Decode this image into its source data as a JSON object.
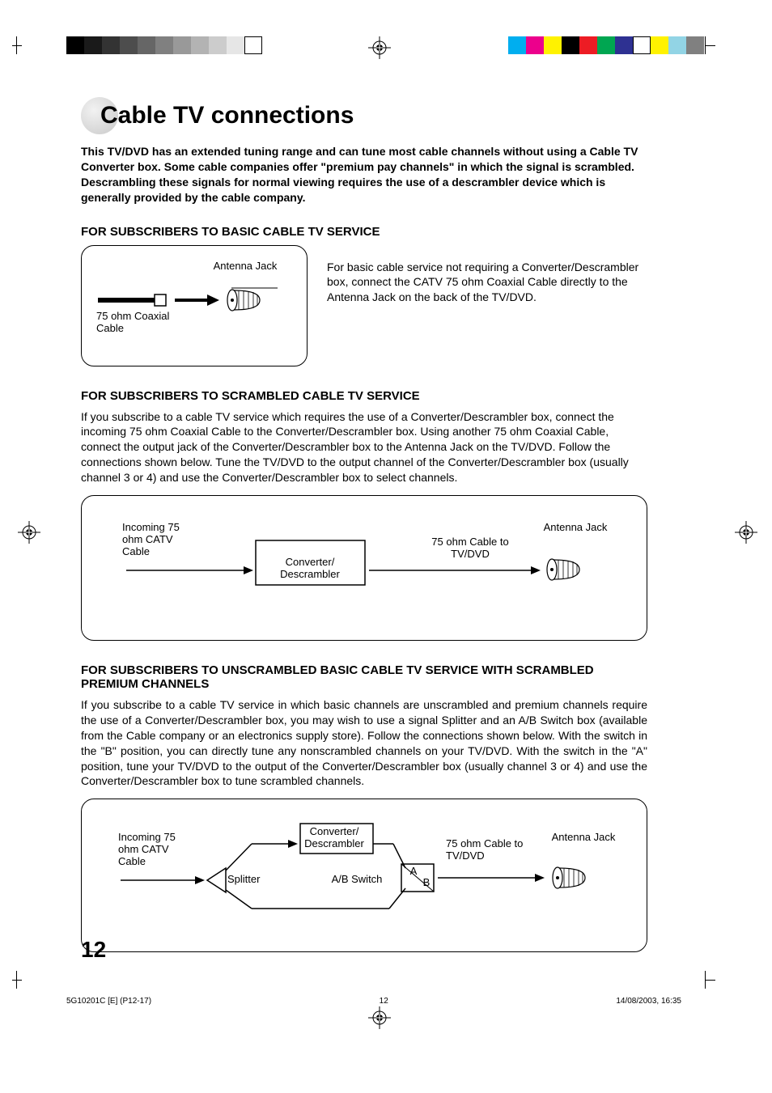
{
  "title": "Cable TV connections",
  "intro": "This TV/DVD has an extended tuning range and can tune most cable channels without using a Cable TV Converter box. Some cable companies offer \"premium pay channels\" in which the signal is scrambled. Descrambling these signals for normal viewing requires the use of a descrambler device which is generally provided by the cable company.",
  "section1": {
    "heading": "FOR SUBSCRIBERS TO BASIC CABLE TV SERVICE",
    "side_text": "For basic cable service not requiring a Converter/Descrambler box, connect the CATV 75 ohm Coaxial Cable directly to the Antenna Jack on the back of the TV/DVD.",
    "labels": {
      "antenna_jack": "Antenna Jack",
      "coax": "75 ohm Coaxial Cable"
    }
  },
  "section2": {
    "heading": "FOR SUBSCRIBERS TO SCRAMBLED CABLE TV SERVICE",
    "body": "If you subscribe to a cable TV service which requires the use of a Converter/Descrambler box, connect the incoming 75 ohm Coaxial Cable to the Converter/Descrambler box. Using another 75 ohm Coaxial Cable, connect the output jack of the Converter/Descrambler box to the Antenna Jack on the TV/DVD. Follow the connections shown below. Tune the TV/DVD to the output channel of the Converter/Descrambler box (usually channel 3 or 4) and use the Converter/Descrambler box to select channels.",
    "labels": {
      "incoming": "Incoming 75 ohm CATV Cable",
      "converter": "Converter/ Descrambler",
      "cable_to_tv": "75 ohm Cable to TV/DVD",
      "antenna_jack": "Antenna Jack"
    }
  },
  "section3": {
    "heading": "FOR SUBSCRIBERS TO UNSCRAMBLED BASIC CABLE TV SERVICE WITH SCRAMBLED PREMIUM CHANNELS",
    "body": "If you subscribe to a cable TV service in which basic channels are unscrambled and premium channels require the use of a Converter/Descrambler box, you may wish to use a signal Splitter and an A/B Switch box (available from the Cable company or an electronics supply store). Follow the connections shown below. With the switch in the \"B\" position, you can directly tune any nonscrambled channels on your TV/DVD. With the switch in the \"A\" position, tune your TV/DVD to the output of the Converter/Descrambler box (usually channel 3 or 4) and use the Converter/Descrambler box to tune scrambled channels.",
    "labels": {
      "incoming": "Incoming 75 ohm CATV Cable",
      "splitter": "Splitter",
      "converter": "Converter/ Descrambler",
      "ab_switch": "A/B Switch",
      "a": "A",
      "b": "B",
      "cable_to_tv": "75 ohm Cable to TV/DVD",
      "antenna_jack": "Antenna Jack"
    }
  },
  "page_number": "12",
  "footer": {
    "left": "5G10201C [E] (P12-17)",
    "center": "12",
    "right": "14/08/2003, 16:35"
  },
  "colors_left": [
    "#000000",
    "#1a1a1a",
    "#333333",
    "#4d4d4d",
    "#666666",
    "#808080",
    "#999999",
    "#b3b3b3",
    "#cccccc",
    "#e6e6e6",
    "#ffffff"
  ],
  "colors_right": [
    "#00aeef",
    "#ec008c",
    "#fff200",
    "#000000",
    "#ed1c24",
    "#00a651",
    "#2e3192",
    "#ffffff",
    "#fff200",
    "#92d4e5",
    "#808080"
  ]
}
